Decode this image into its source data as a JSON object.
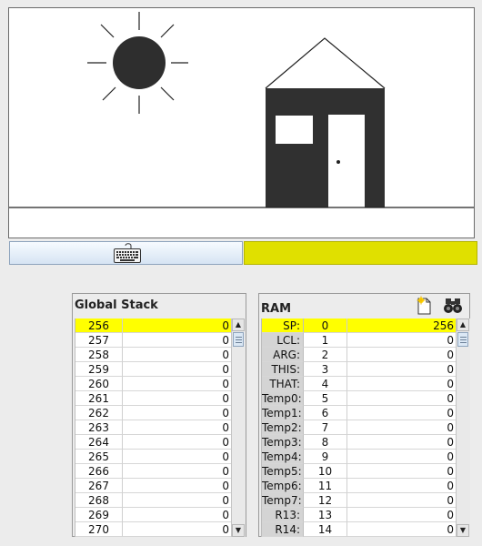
{
  "screen": {
    "drawing": "sun-and-house"
  },
  "status": {
    "color": "#e0e000"
  },
  "global_stack": {
    "title": "Global Stack",
    "selected_index": 0,
    "rows": [
      {
        "addr": "256",
        "value": "0"
      },
      {
        "addr": "257",
        "value": "0"
      },
      {
        "addr": "258",
        "value": "0"
      },
      {
        "addr": "259",
        "value": "0"
      },
      {
        "addr": "260",
        "value": "0"
      },
      {
        "addr": "261",
        "value": "0"
      },
      {
        "addr": "262",
        "value": "0"
      },
      {
        "addr": "263",
        "value": "0"
      },
      {
        "addr": "264",
        "value": "0"
      },
      {
        "addr": "265",
        "value": "0"
      },
      {
        "addr": "266",
        "value": "0"
      },
      {
        "addr": "267",
        "value": "0"
      },
      {
        "addr": "268",
        "value": "0"
      },
      {
        "addr": "269",
        "value": "0"
      },
      {
        "addr": "270",
        "value": "0"
      }
    ]
  },
  "ram": {
    "title": "RAM",
    "selected_index": 0,
    "rows": [
      {
        "label": "SP:",
        "addr": "0",
        "value": "256"
      },
      {
        "label": "LCL:",
        "addr": "1",
        "value": "0"
      },
      {
        "label": "ARG:",
        "addr": "2",
        "value": "0"
      },
      {
        "label": "THIS:",
        "addr": "3",
        "value": "0"
      },
      {
        "label": "THAT:",
        "addr": "4",
        "value": "0"
      },
      {
        "label": "Temp0:",
        "addr": "5",
        "value": "0"
      },
      {
        "label": "Temp1:",
        "addr": "6",
        "value": "0"
      },
      {
        "label": "Temp2:",
        "addr": "7",
        "value": "0"
      },
      {
        "label": "Temp3:",
        "addr": "8",
        "value": "0"
      },
      {
        "label": "Temp4:",
        "addr": "9",
        "value": "0"
      },
      {
        "label": "Temp5:",
        "addr": "10",
        "value": "0"
      },
      {
        "label": "Temp6:",
        "addr": "11",
        "value": "0"
      },
      {
        "label": "Temp7:",
        "addr": "12",
        "value": "0"
      },
      {
        "label": "R13:",
        "addr": "13",
        "value": "0"
      },
      {
        "label": "R14:",
        "addr": "14",
        "value": "0"
      }
    ]
  },
  "icons": {
    "new": "new-file-icon",
    "find": "binoculars-icon",
    "keyboard": "keyboard-icon"
  }
}
